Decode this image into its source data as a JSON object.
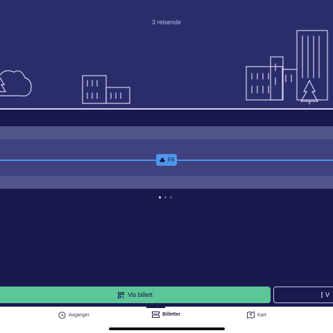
{
  "header": {
    "travellers": "3 reisende"
  },
  "route": {
    "zone_label": "F6",
    "icon": "ferry-icon"
  },
  "pager": {
    "count": 3,
    "active_index": 0
  },
  "actions": {
    "show_ticket_label": "Vis billett",
    "show_ticket_icon": "qr-code-icon",
    "more_label": "V",
    "more_icon": "kebab-menu-icon"
  },
  "tabs": [
    {
      "label": "Avganger",
      "icon": "clock-icon",
      "active": false
    },
    {
      "label": "Billetter",
      "icon": "ticket-icon",
      "active": true
    },
    {
      "label": "Kart",
      "icon": "map-icon",
      "active": false
    }
  ],
  "colors": {
    "hero_bg": "#2b2d6b",
    "lower_bg": "#181a4e",
    "route_blue": "#4f95e8",
    "primary_button": "#5cc699"
  }
}
